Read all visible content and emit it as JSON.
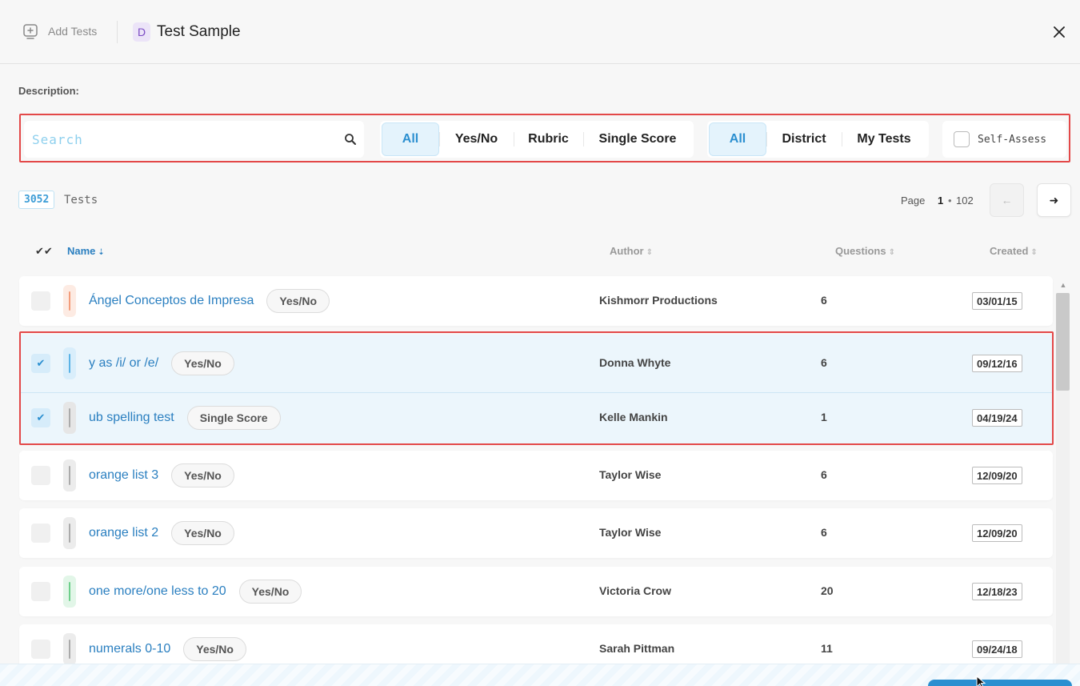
{
  "header": {
    "add_tests_label": "Add Tests",
    "badge_letter": "D",
    "title": "Test Sample"
  },
  "description_label": "Description:",
  "search": {
    "placeholder": "Search",
    "value": ""
  },
  "type_filter": {
    "options": [
      "All",
      "Yes/No",
      "Rubric",
      "Single Score"
    ],
    "selected": "All"
  },
  "scope_filter": {
    "options": [
      "All",
      "District",
      "My Tests"
    ],
    "selected": "All"
  },
  "self_assess_label": "Self-Assess",
  "results": {
    "count": "3052",
    "label": "Tests"
  },
  "pager": {
    "label": "Page",
    "current": "1",
    "separator": "•",
    "total": "102",
    "prev_icon": "←",
    "next_icon": "➜"
  },
  "table": {
    "select_all_icon": "✔✔",
    "columns": {
      "name": "Name",
      "author": "Author",
      "questions": "Questions",
      "created": "Created"
    },
    "rows": [
      {
        "name": "Ángel Conceptos de Impresa",
        "type": "Yes/No",
        "author": "Kishmorr Productions",
        "questions": "6",
        "created": "03/01/15",
        "selected": false,
        "bar_color": "#f39c7a",
        "bar_bg": "#fdebe3"
      },
      {
        "name": "y as /i/ or /e/",
        "type": "Yes/No",
        "author": "Donna Whyte",
        "questions": "6",
        "created": "09/12/16",
        "selected": true,
        "bar_color": "#5ab3e6",
        "bar_bg": "#d9eefb"
      },
      {
        "name": "ub spelling test",
        "type": "Single Score",
        "author": "Kelle Mankin",
        "questions": "1",
        "created": "04/19/24",
        "selected": true,
        "bar_color": "#aaaaaa",
        "bar_bg": "#e6e6e6"
      },
      {
        "name": "orange list 3",
        "type": "Yes/No",
        "author": "Taylor Wise",
        "questions": "6",
        "created": "12/09/20",
        "selected": false,
        "bar_color": "#aaaaaa",
        "bar_bg": "#ececec"
      },
      {
        "name": "orange list 2",
        "type": "Yes/No",
        "author": "Taylor Wise",
        "questions": "6",
        "created": "12/09/20",
        "selected": false,
        "bar_color": "#aaaaaa",
        "bar_bg": "#ececec"
      },
      {
        "name": "one more/one less to 20",
        "type": "Yes/No",
        "author": "Victoria Crow",
        "questions": "20",
        "created": "12/18/23",
        "selected": false,
        "bar_color": "#6dcf8a",
        "bar_bg": "#e2f6e8"
      },
      {
        "name": "numerals 0-10",
        "type": "Yes/No",
        "author": "Sarah Pittman",
        "questions": "11",
        "created": "09/24/18",
        "selected": false,
        "bar_color": "#aaaaaa",
        "bar_bg": "#ececec"
      }
    ]
  }
}
